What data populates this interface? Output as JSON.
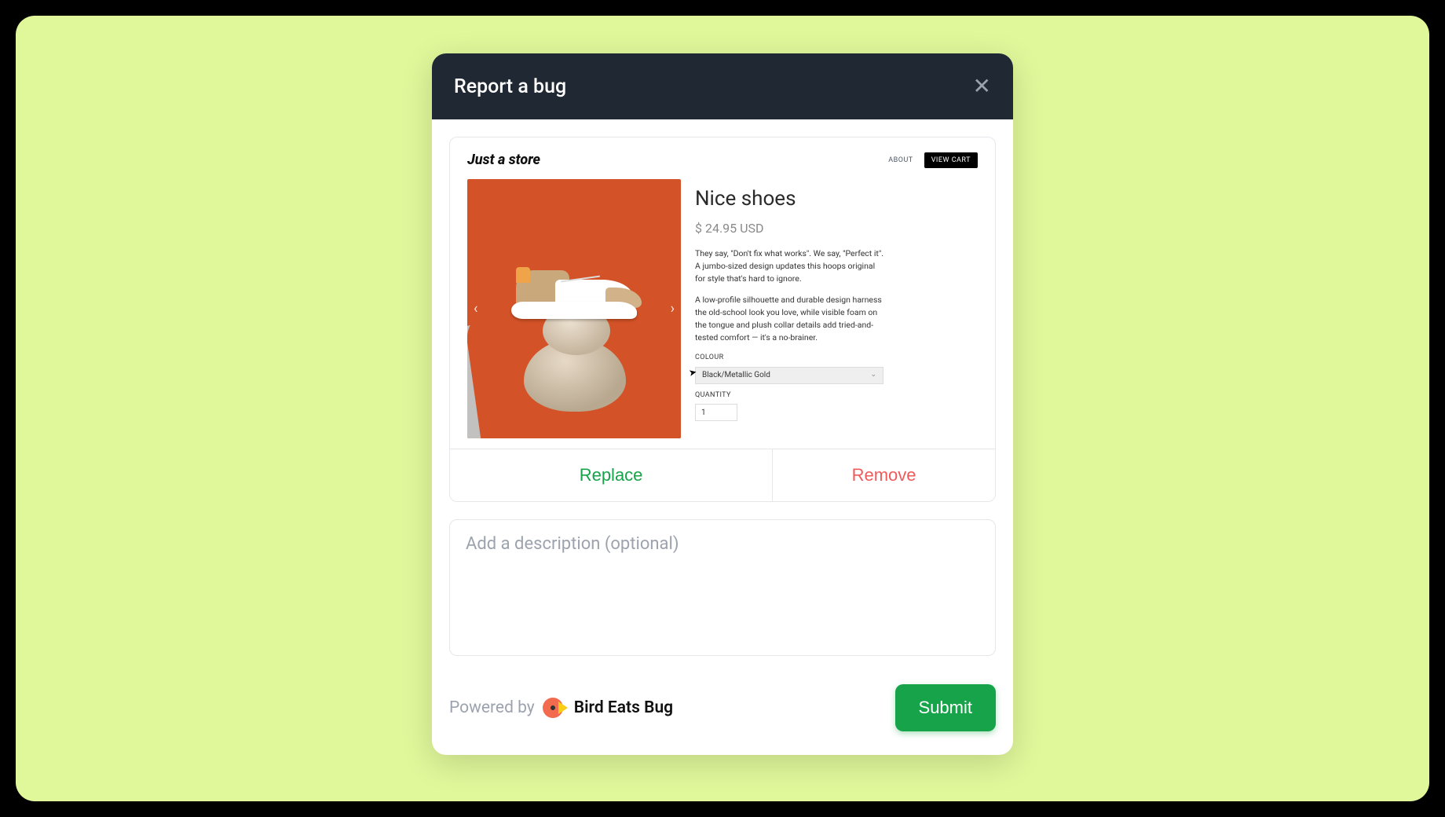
{
  "modal": {
    "title": "Report a bug"
  },
  "screenshot": {
    "store_name": "Just a store",
    "nav": {
      "about": "ABOUT",
      "view_cart": "VIEW CART"
    },
    "product": {
      "title": "Nice shoes",
      "price": "$ 24.95 USD",
      "desc1": "They say, \"Don't fix what works\". We say, \"Perfect it\". A jumbo-sized design updates this hoops original for style that's hard to ignore.",
      "desc2": "A low-profile silhouette and durable design harness the old-school look you love, while visible foam on the tongue and plush collar details add tried-and-tested comfort — it's a no-brainer.",
      "colour_label": "COLOUR",
      "colour_value": "Black/Metallic Gold",
      "quantity_label": "QUANTITY",
      "quantity_value": "1"
    }
  },
  "actions": {
    "replace": "Replace",
    "remove": "Remove"
  },
  "description": {
    "placeholder": "Add a description (optional)"
  },
  "footer": {
    "powered_by": "Powered by",
    "brand": "Bird Eats Bug",
    "submit": "Submit"
  }
}
